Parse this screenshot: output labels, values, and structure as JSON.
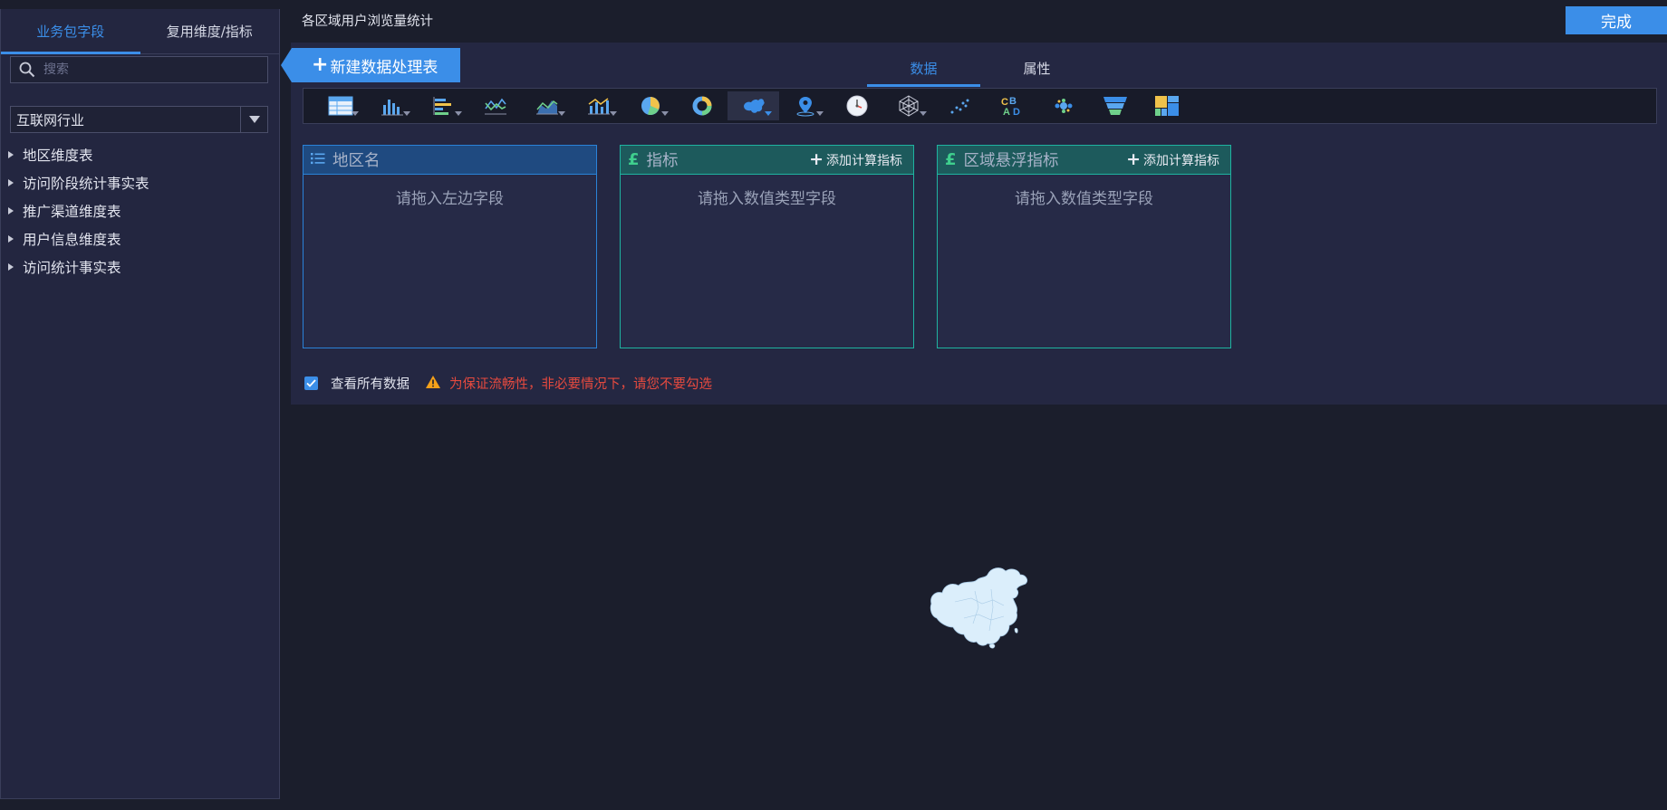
{
  "sidebar": {
    "tabs": [
      {
        "label": "业务包字段",
        "active": true
      },
      {
        "label": "复用维度/指标",
        "active": false
      }
    ],
    "search_placeholder": "搜索",
    "industry": "互联网行业",
    "tree": [
      {
        "label": "地区维度表"
      },
      {
        "label": "访问阶段统计事实表"
      },
      {
        "label": "推广渠道维度表"
      },
      {
        "label": "用户信息维度表"
      },
      {
        "label": "访问统计事实表"
      }
    ]
  },
  "header": {
    "title": "各区域用户浏览量统计",
    "done_label": "完成"
  },
  "panel": {
    "new_table_label": "新建数据处理表",
    "tabs": [
      {
        "label": "数据",
        "active": true
      },
      {
        "label": "属性",
        "active": false
      }
    ],
    "chart_types": [
      "table-chart-icon",
      "bar-chart-icon",
      "horizontal-bar-icon",
      "line-chart-icon",
      "area-chart-icon",
      "combo-chart-icon",
      "pie-chart-icon",
      "donut-chart-icon",
      "region-map-icon",
      "point-map-icon",
      "gauge-chart-icon",
      "radar-chart-icon",
      "scatter-chart-icon",
      "word-cloud-icon",
      "bubble-chart-icon",
      "funnel-chart-icon",
      "treemap-chart-icon"
    ],
    "selected_chart": "region-map-icon",
    "regions": [
      {
        "title": "地区名",
        "hint": "请拖入左边字段",
        "add_label": ""
      },
      {
        "title": "指标",
        "hint": "请拖入数值类型字段",
        "add_label": "添加计算指标"
      },
      {
        "title": "区域悬浮指标",
        "hint": "请拖入数值类型字段",
        "add_label": "添加计算指标"
      }
    ],
    "view_all_label": "查看所有数据",
    "view_all_checked": true,
    "warning": "为保证流畅性，非必要情况下，请您不要勾选"
  },
  "colors": {
    "accent": "#3b8ee8",
    "teal": "#1fb3a0",
    "warning": "#e64a3f"
  }
}
